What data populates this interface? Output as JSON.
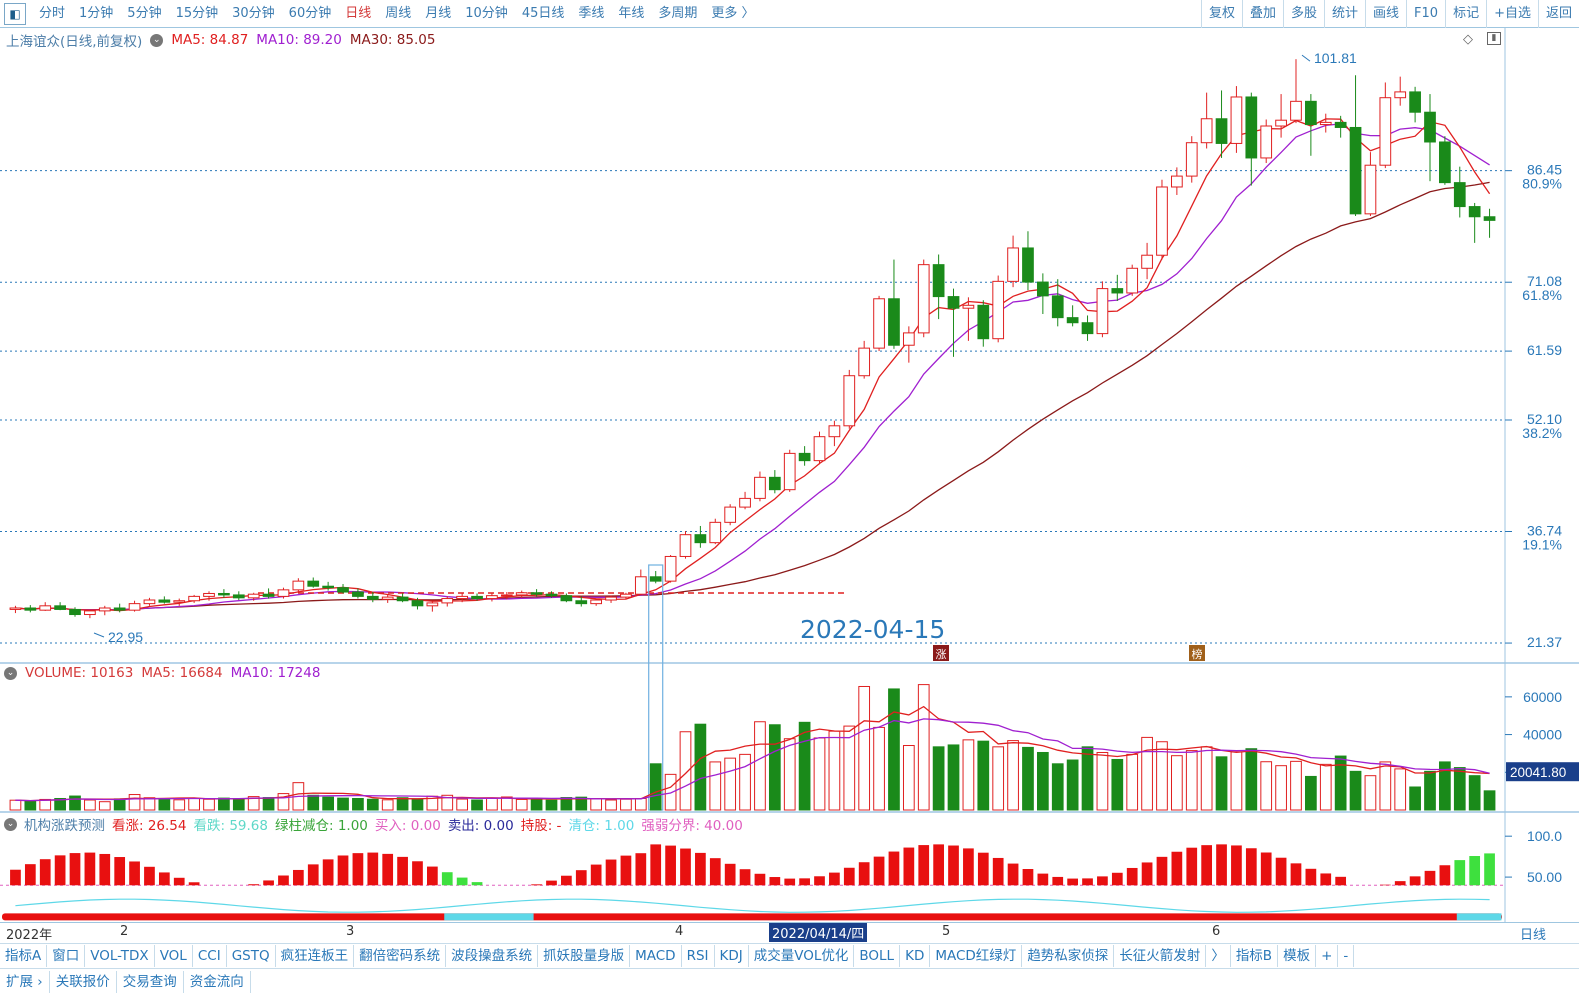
{
  "topbar": {
    "periods": [
      "分时",
      "1分钟",
      "5分钟",
      "15分钟",
      "30分钟",
      "60分钟",
      "日线",
      "周线",
      "月线",
      "10分钟",
      "45日线",
      "季线",
      "年线",
      "多周期",
      "更多 〉"
    ],
    "active_period": "日线",
    "tools": [
      "复权",
      "叠加",
      "多股",
      "统计",
      "画线",
      "F10",
      "标记",
      "+自选",
      "返回"
    ]
  },
  "main_legend": {
    "title": "上海谊众(日线,前复权)",
    "ma5": "MA5: 84.87",
    "ma10": "MA10: 89.20",
    "ma30": "MA30: 85.05"
  },
  "price_axis": [
    {
      "price": 86.45,
      "pct": "80.9%"
    },
    {
      "price": 71.08,
      "pct": "61.8%"
    },
    {
      "price": 61.59,
      "pct": ""
    },
    {
      "price": 52.1,
      "pct": "38.2%"
    },
    {
      "price": 36.74,
      "pct": "19.1%"
    },
    {
      "price": 21.37,
      "pct": ""
    }
  ],
  "price_axis_labels": [
    "86.45",
    "71.08",
    "61.59",
    "52.10",
    "36.74",
    "21.37"
  ],
  "pct_labels": [
    "80.9%",
    "61.8%",
    "38.2%",
    "19.1%"
  ],
  "annotations": {
    "high": "101.81",
    "low": "22.95",
    "date_label": "2022-04-15",
    "badge_zhang": "涨",
    "badge_bang": "榜"
  },
  "volume_legend": {
    "volume": "VOLUME: 10163",
    "ma5": "MA5: 16684",
    "ma10": "MA10: 17248"
  },
  "volume_axis": [
    "60000",
    "40000",
    "20000"
  ],
  "volume_highlight": "20041.80",
  "indicator_legend": {
    "name": "机构涨跌预测",
    "kanzhang": "看涨: 26.54",
    "kandie": "看跌: 59.68",
    "lvzhu": "绿柱减仓: 1.00",
    "mairu": "买入: 0.00",
    "maichu": "卖出: 0.00",
    "chigu": "持股: -",
    "qingcang": "清仓: 1.00",
    "qiangruo": "强弱分界: 40.00"
  },
  "indicator_axis": [
    "100.0",
    "50.00"
  ],
  "datebar": {
    "year": "2022年",
    "months": [
      "2",
      "3",
      "4",
      "5",
      "6"
    ],
    "cursor_date": "2022/04/14/四",
    "period": "日线"
  },
  "indicator_tabs": [
    "指标A",
    "窗口",
    "VOL-TDX",
    "VOL",
    "CCI",
    "GSTQ",
    "疯狂连板王",
    "翻倍密码系统",
    "波段操盘系统",
    "抓妖股量身版",
    "MACD",
    "RSI",
    "KDJ",
    "成交量VOL优化",
    "BOLL",
    "KD",
    "MACD红绿灯",
    "趋势私家侦探",
    "长征火箭发射",
    "〉",
    "指标B",
    "模板",
    "+",
    "-"
  ],
  "bottom_tabs": [
    "扩展 ›",
    "关联报价",
    "交易查询",
    "资金流向"
  ],
  "colors": {
    "up": "#e02020",
    "down": "#1a8a1a",
    "ma5": "#e02020",
    "ma10": "#a020d0",
    "ma30": "#8b1a1a",
    "axis": "#2a78b8"
  },
  "chart_data": {
    "type": "candlestick",
    "title": "上海谊众(日线,前复权)",
    "ylim": [
      20,
      105
    ],
    "high_label": 101.81,
    "low_label": 22.95,
    "candles": [
      [
        26,
        26.5,
        25.5,
        26.2
      ],
      [
        26.2,
        26.6,
        25.6,
        25.9
      ],
      [
        25.9,
        27,
        25.8,
        26.5
      ],
      [
        26.5,
        27,
        25.9,
        26.0
      ],
      [
        26,
        26.3,
        25,
        25.3
      ],
      [
        25.3,
        26,
        24.8,
        25.8
      ],
      [
        25.8,
        26.5,
        25.2,
        26.2
      ],
      [
        26.2,
        26.8,
        25.6,
        25.9
      ],
      [
        25.9,
        27.2,
        25.7,
        26.8
      ],
      [
        26.8,
        27.6,
        26.5,
        27.3
      ],
      [
        27.3,
        27.8,
        26.8,
        27
      ],
      [
        27,
        27.5,
        26.5,
        27.2
      ],
      [
        27.2,
        28,
        26.9,
        27.8
      ],
      [
        27.8,
        28.5,
        27.2,
        28.2
      ],
      [
        28.2,
        28.8,
        27.6,
        28
      ],
      [
        28,
        28.5,
        27.3,
        27.6
      ],
      [
        27.6,
        28.3,
        27.2,
        28.1
      ],
      [
        28.1,
        28.9,
        27.5,
        27.8
      ],
      [
        27.8,
        29,
        27.5,
        28.7
      ],
      [
        28.7,
        30.3,
        28.3,
        29.9
      ],
      [
        29.9,
        30.4,
        29,
        29.2
      ],
      [
        29.2,
        29.8,
        28.6,
        29.0
      ],
      [
        29,
        29.5,
        28.2,
        28.4
      ],
      [
        28.4,
        28.9,
        27.5,
        27.8
      ],
      [
        27.8,
        28.4,
        27,
        27.4
      ],
      [
        27.4,
        28,
        26.9,
        27.7
      ],
      [
        27.7,
        28.2,
        27,
        27.2
      ],
      [
        27.2,
        27.6,
        26,
        26.5
      ],
      [
        26.5,
        27.2,
        25.7,
        26.9
      ],
      [
        26.9,
        27.8,
        26.4,
        27.5
      ],
      [
        27.5,
        28.3,
        27,
        27.8
      ],
      [
        27.8,
        28.2,
        27.2,
        27.5
      ],
      [
        27.5,
        28.2,
        27.1,
        27.9
      ],
      [
        27.9,
        28.4,
        27.4,
        28.0
      ],
      [
        28,
        28.6,
        27.6,
        28.3
      ],
      [
        28.3,
        28.8,
        27.8,
        28.1
      ],
      [
        28.1,
        28.5,
        27.6,
        27.9
      ],
      [
        27.9,
        28.2,
        27,
        27.2
      ],
      [
        27.2,
        27.8,
        26.4,
        26.8
      ],
      [
        26.8,
        27.5,
        26.5,
        27.3
      ],
      [
        27.3,
        27.9,
        26.9,
        27.7
      ],
      [
        27.7,
        28.3,
        27.4,
        28.1
      ],
      [
        28.1,
        31.5,
        28,
        30.5
      ],
      [
        30.5,
        31.3,
        29.6,
        29.9
      ],
      [
        29.9,
        33.5,
        29.7,
        33.3
      ],
      [
        33.3,
        36.8,
        33,
        36.3
      ],
      [
        36.3,
        37.5,
        34.5,
        35.2
      ],
      [
        35.2,
        38.5,
        35,
        38
      ],
      [
        38,
        40.5,
        37.6,
        40.1
      ],
      [
        40.1,
        42.2,
        39.8,
        41.3
      ],
      [
        41.3,
        45,
        40.9,
        44.2
      ],
      [
        44.2,
        45.2,
        42,
        42.5
      ],
      [
        42.5,
        48,
        42.2,
        47.5
      ],
      [
        47.5,
        48.5,
        45.8,
        46.5
      ],
      [
        46.5,
        50.5,
        46,
        49.8
      ],
      [
        49.8,
        52,
        48.5,
        51.3
      ],
      [
        51.3,
        59,
        50.9,
        58.2
      ],
      [
        58.2,
        63,
        57.8,
        62
      ],
      [
        62,
        69.2,
        61.6,
        68.8
      ],
      [
        68.8,
        74.2,
        61.9,
        62.4
      ],
      [
        62.4,
        65,
        60,
        64.1
      ],
      [
        64.1,
        74.2,
        63.5,
        73.5
      ],
      [
        73.5,
        74.9,
        66,
        69.1
      ],
      [
        69.1,
        70.2,
        60.8,
        67.5
      ],
      [
        67.5,
        69,
        63,
        67.9
      ],
      [
        67.9,
        68.6,
        62.2,
        63.3
      ],
      [
        63.3,
        72,
        62.8,
        71.2
      ],
      [
        71.2,
        77.5,
        70.4,
        75.8
      ],
      [
        75.8,
        78.1,
        70,
        71.1
      ],
      [
        71.1,
        72.3,
        66.7,
        69.2
      ],
      [
        69.2,
        71.5,
        65,
        66.2
      ],
      [
        66.2,
        67.9,
        65,
        65.5
      ],
      [
        65.5,
        66.5,
        63,
        64
      ],
      [
        64,
        71.2,
        63.5,
        70.2
      ],
      [
        70.2,
        72.1,
        68.5,
        69.6
      ],
      [
        69.6,
        73.5,
        69.2,
        73
      ],
      [
        73,
        76.5,
        71.5,
        74.8
      ],
      [
        74.8,
        85.2,
        74.2,
        84.2
      ],
      [
        84.2,
        86.9,
        83.1,
        85.7
      ],
      [
        85.7,
        91.2,
        84.8,
        90.3
      ],
      [
        90.3,
        97.2,
        89.5,
        93.6
      ],
      [
        93.6,
        97.5,
        88.2,
        90.2
      ],
      [
        90.2,
        98.1,
        88.9,
        96.6
      ],
      [
        96.6,
        97.2,
        84.4,
        88.2
      ],
      [
        88.2,
        93.5,
        87.5,
        92.6
      ],
      [
        92.6,
        97,
        91,
        93.4
      ],
      [
        93.4,
        101.81,
        93,
        96
      ],
      [
        96,
        97,
        88.5,
        92.8
      ],
      [
        92.8,
        94.3,
        91.7,
        93.1
      ],
      [
        93.1,
        94,
        91,
        92.4
      ],
      [
        92.4,
        99.6,
        80.2,
        80.5
      ],
      [
        80.5,
        89,
        80.2,
        87.2
      ],
      [
        87.2,
        98.6,
        86.8,
        96.5
      ],
      [
        96.5,
        99.4,
        95.4,
        97.3
      ],
      [
        97.3,
        98,
        93.1,
        94.5
      ],
      [
        94.5,
        97,
        85,
        90.4
      ],
      [
        90.4,
        91.2,
        84.5,
        84.8
      ],
      [
        84.8,
        87,
        80,
        81.5
      ],
      [
        81.5,
        82,
        76.5,
        80.1
      ],
      [
        80.1,
        81.2,
        77.2,
        79.6
      ]
    ],
    "volume": [
      5200,
      4800,
      5600,
      6100,
      7400,
      5300,
      4400,
      5900,
      8200,
      6500,
      5800,
      5400,
      6100,
      5700,
      6300,
      5900,
      7100,
      6600,
      8700,
      14500,
      7800,
      6800,
      6300,
      6100,
      5700,
      5400,
      6500,
      5900,
      7300,
      7800,
      5800,
      5300,
      6100,
      6900,
      5600,
      5400,
      5200,
      6600,
      6800,
      5900,
      5300,
      5700,
      6100,
      24500,
      18900,
      41500,
      45500,
      25500,
      27500,
      29500,
      46800,
      45200,
      37800,
      46500,
      38200,
      41800,
      44500,
      65500,
      43800,
      64200,
      34200,
      66500,
      33500,
      34500,
      37200,
      36500,
      33500,
      36800,
      33200,
      30500,
      24500,
      26500,
      33500,
      30500,
      26800,
      29500,
      38500,
      36200,
      28800,
      31500,
      33500,
      28200,
      30800,
      32500,
      25600,
      23500,
      25800,
      17800,
      24200,
      28600,
      20500,
      18200,
      25500,
      21800,
      12200,
      20500,
      25500,
      22500,
      18200,
      10163
    ],
    "volume_ma5": 16684,
    "volume_ma10": 17248,
    "ma5_last": 84.87,
    "ma10_last": 89.2,
    "ma30_last": 85.05
  }
}
